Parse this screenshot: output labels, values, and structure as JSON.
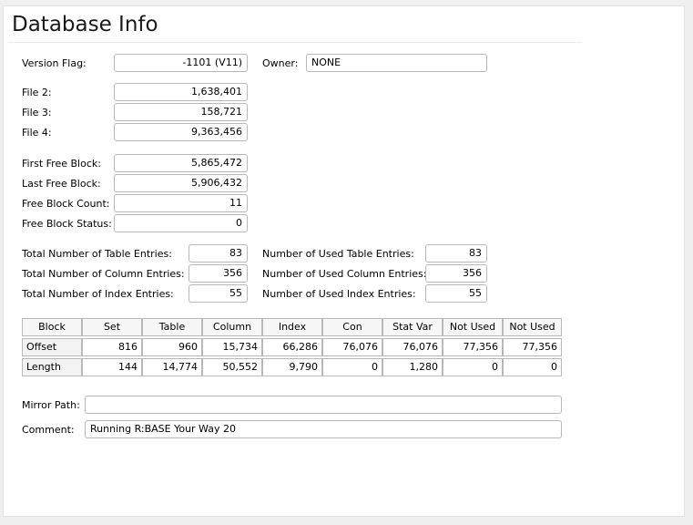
{
  "title": "Database Info",
  "version": {
    "label": "Version Flag:",
    "value": "-1101  (V11)"
  },
  "owner": {
    "label": "Owner:",
    "value": "NONE"
  },
  "files": [
    {
      "label": "File 2:",
      "value": "1,638,401"
    },
    {
      "label": "File 3:",
      "value": "158,721"
    },
    {
      "label": "File 4:",
      "value": "9,363,456"
    }
  ],
  "blocks": [
    {
      "label": "First Free Block:",
      "value": "5,865,472"
    },
    {
      "label": "Last Free Block:",
      "value": "5,906,432"
    },
    {
      "label": "Free Block Count:",
      "value": "11"
    },
    {
      "label": "Free Block Status:",
      "value": "0"
    }
  ],
  "totals": [
    {
      "label": "Total Number of Table Entries:",
      "value": "83"
    },
    {
      "label": "Total Number of Column Entries:",
      "value": "356"
    },
    {
      "label": "Total Number of Index Entries:",
      "value": "55"
    }
  ],
  "used": [
    {
      "label": "Number of Used Table Entries:",
      "value": "83"
    },
    {
      "label": "Number of Used Column Entries:",
      "value": "356"
    },
    {
      "label": "Number of Used Index Entries:",
      "value": "55"
    }
  ],
  "block_table": {
    "headers": [
      "Block",
      "Set",
      "Table",
      "Column",
      "Index",
      "Con",
      "Stat Var",
      "Not Used",
      "Not Used"
    ],
    "rows": [
      [
        "Offset",
        "816",
        "960",
        "15,734",
        "66,286",
        "76,076",
        "76,076",
        "77,356",
        "77,356"
      ],
      [
        "Length",
        "144",
        "14,774",
        "50,552",
        "9,790",
        "0",
        "1,280",
        "0",
        "0"
      ]
    ]
  },
  "mirror_path": {
    "label": "Mirror Path:",
    "value": ""
  },
  "comment": {
    "label": "Comment:",
    "value": "Running R:BASE Your Way 20"
  }
}
